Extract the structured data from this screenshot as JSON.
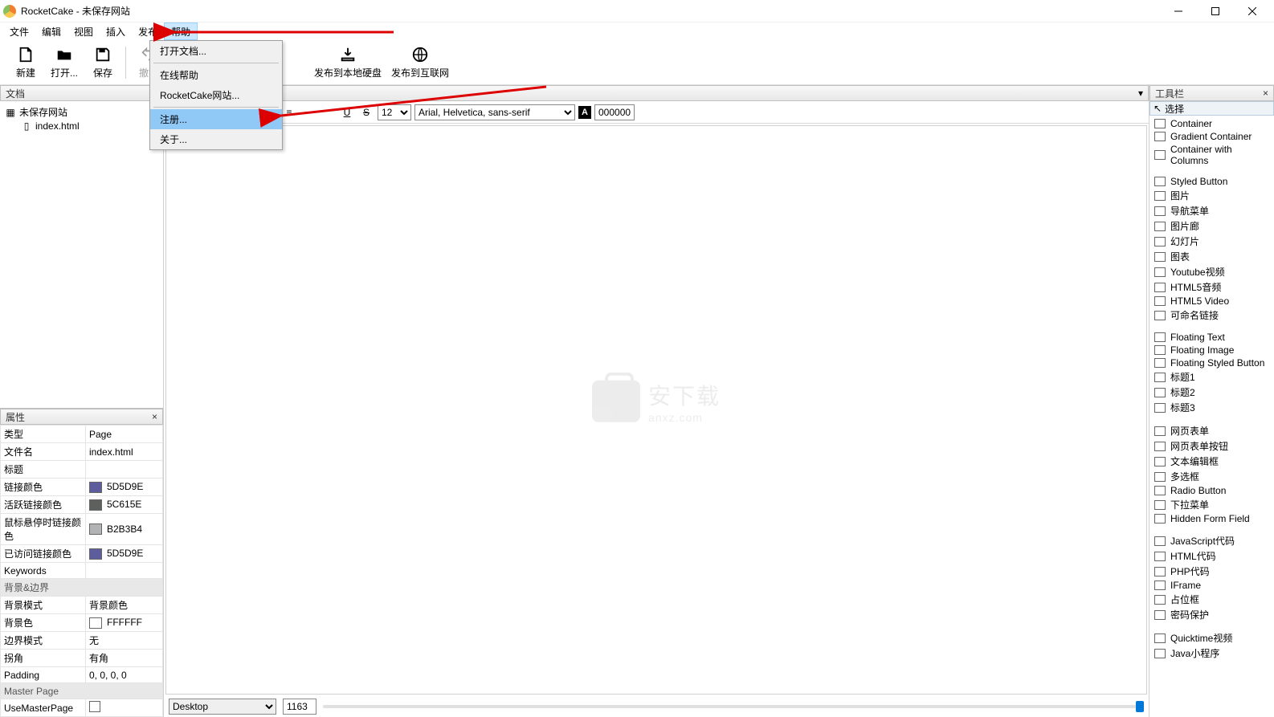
{
  "title": "RocketCake - 未保存网站",
  "menus": [
    "文件",
    "编辑",
    "视图",
    "插入",
    "发布",
    "帮助"
  ],
  "help_menu": {
    "open_doc": "打开文档...",
    "online_help": "在线帮助",
    "site": "RocketCake网站...",
    "register": "注册...",
    "about": "关于..."
  },
  "toolbar": {
    "new": "新建",
    "open": "打开...",
    "save": "保存",
    "undo": "撤销",
    "pub_local": "发布到本地硬盘",
    "pub_web": "发布到互联网"
  },
  "doc_panel": {
    "title": "文档",
    "root": "未保存网站",
    "file": "index.html"
  },
  "prop_panel": {
    "title": "属性",
    "rows": {
      "type_k": "类型",
      "type_v": "Page",
      "name_k": "文件名",
      "name_v": "index.html",
      "title_k": "标题",
      "title_v": "",
      "link_k": "链接颜色",
      "link_v": "5D5D9E",
      "link_c": "#5D5D9E",
      "alink_k": "活跃链接颜色",
      "alink_v": "5C615E",
      "alink_c": "#5C615E",
      "hlink_k": "鼠标悬停时链接颜色",
      "hlink_v": "B2B3B4",
      "hlink_c": "#B2B3B4",
      "vlink_k": "已访问链接颜色",
      "vlink_v": "5D5D9E",
      "vlink_c": "#5D5D9E",
      "kw_k": "Keywords",
      "kw_v": "",
      "grp1": "背景&边界",
      "bgmode_k": "背景模式",
      "bgmode_v": "背景颜色",
      "bgcolor_k": "背景色",
      "bgcolor_v": "FFFFFF",
      "bgcolor_c": "#FFFFFF",
      "border_k": "边界模式",
      "border_v": "无",
      "corner_k": "拐角",
      "corner_v": "有角",
      "pad_k": "Padding",
      "pad_v": "0, 0, 0, 0",
      "grp2": "Master Page",
      "ump_k": "UseMasterPage"
    }
  },
  "format": {
    "size": "12",
    "font": "Arial, Helvetica, sans-serif",
    "color": "000000"
  },
  "bottom": {
    "device": "Desktop",
    "width": "1163"
  },
  "tools_panel": {
    "title": "工具栏",
    "select": "选择"
  },
  "tools": [
    "Container",
    "Gradient Container",
    "Container with Columns",
    "",
    "Styled Button",
    "图片",
    "导航菜单",
    "图片廊",
    "幻灯片",
    "图表",
    "Youtube视频",
    "HTML5音频",
    "HTML5 Video",
    "可命名链接",
    "",
    "Floating Text",
    "Floating Image",
    "Floating Styled Button",
    "标题1",
    "标题2",
    "标题3",
    "",
    "网页表单",
    "网页表单按钮",
    "文本编辑框",
    "多选框",
    "Radio Button",
    "下拉菜单",
    "Hidden Form Field",
    "",
    "JavaScript代码",
    "HTML代码",
    "PHP代码",
    "IFrame",
    "占位框",
    "密码保护",
    "",
    "Quicktime视频",
    "Java小程序"
  ],
  "watermark": {
    "brand": "安下载",
    "url": "anxz.com"
  }
}
